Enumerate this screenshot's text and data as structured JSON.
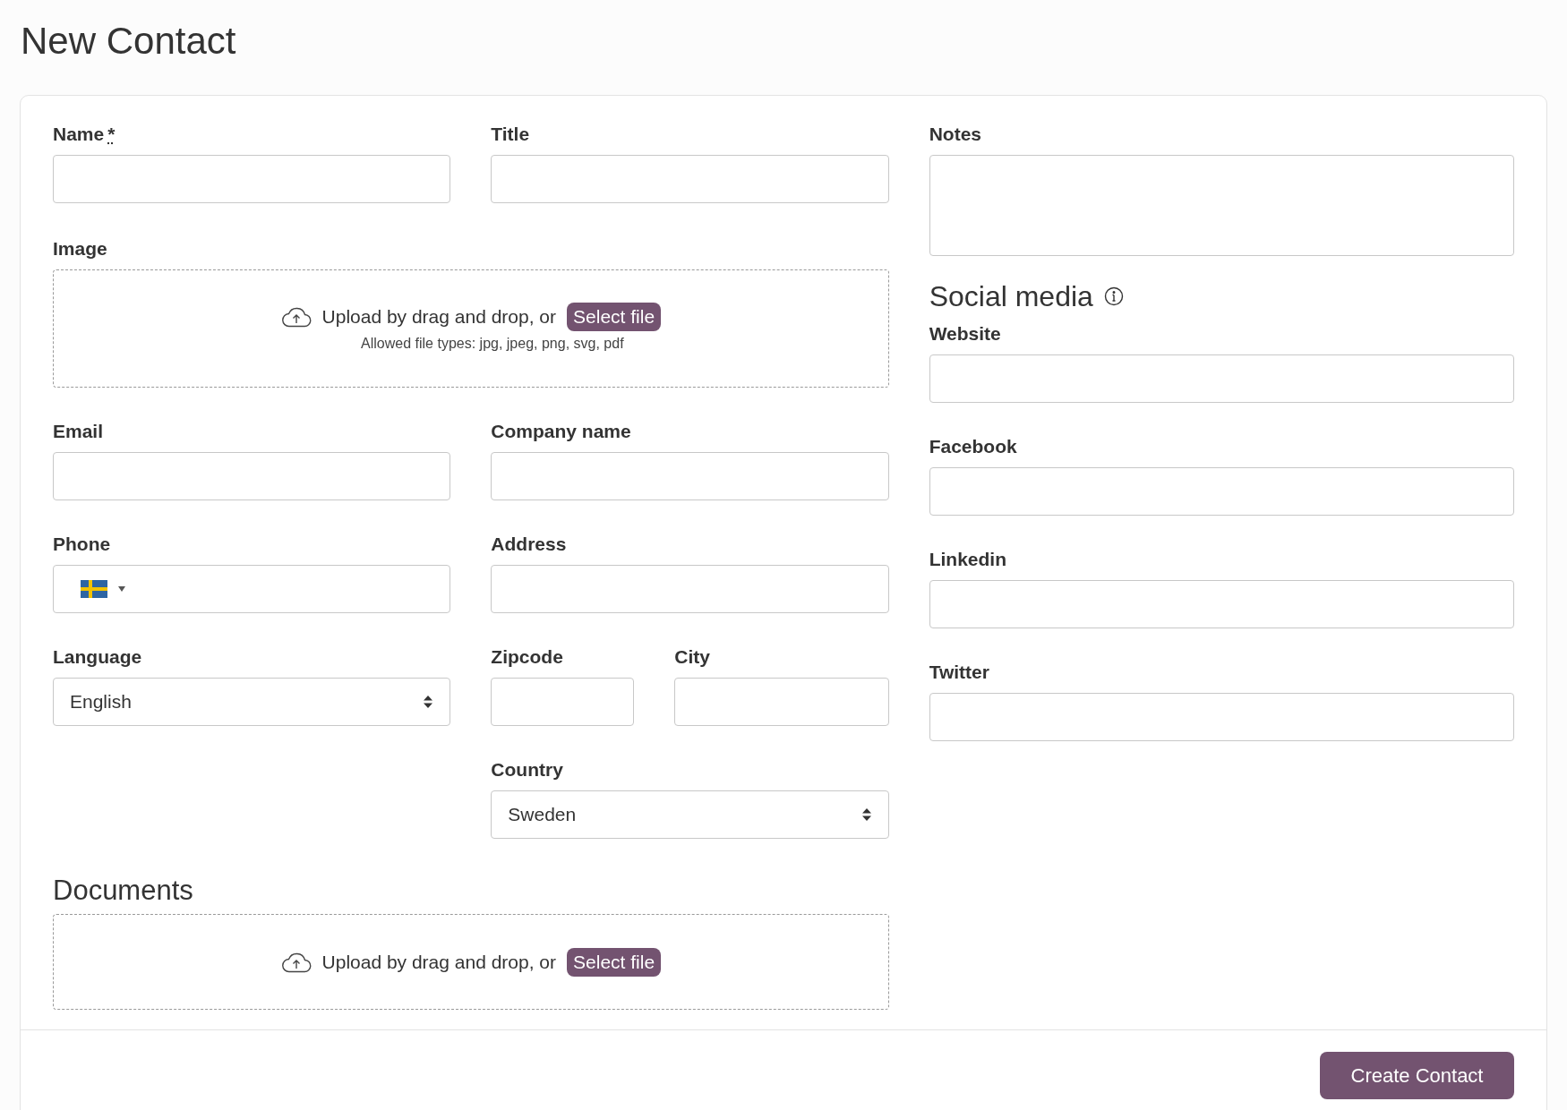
{
  "page_title": "New Contact",
  "name_field": {
    "label": "Name",
    "required_mark": "*"
  },
  "title_field": {
    "label": "Title"
  },
  "image": {
    "label": "Image",
    "upload_text": "Upload by drag and drop, or",
    "button": "Select file",
    "hint": "Allowed file types: jpg, jpeg, png, svg, pdf"
  },
  "email": {
    "label": "Email"
  },
  "company_name": {
    "label": "Company name"
  },
  "phone": {
    "label": "Phone"
  },
  "address": {
    "label": "Address"
  },
  "language": {
    "label": "Language",
    "value": "English"
  },
  "zipcode": {
    "label": "Zipcode"
  },
  "city": {
    "label": "City"
  },
  "country": {
    "label": "Country",
    "value": "Sweden"
  },
  "documents": {
    "heading": "Documents",
    "upload_text": "Upload by drag and drop, or",
    "button": "Select file"
  },
  "notes": {
    "label": "Notes"
  },
  "social_media": {
    "heading": "Social media",
    "fields": [
      {
        "label": "Website"
      },
      {
        "label": "Facebook"
      },
      {
        "label": "Linkedin"
      },
      {
        "label": "Twitter"
      }
    ]
  },
  "submit_button": "Create Contact"
}
